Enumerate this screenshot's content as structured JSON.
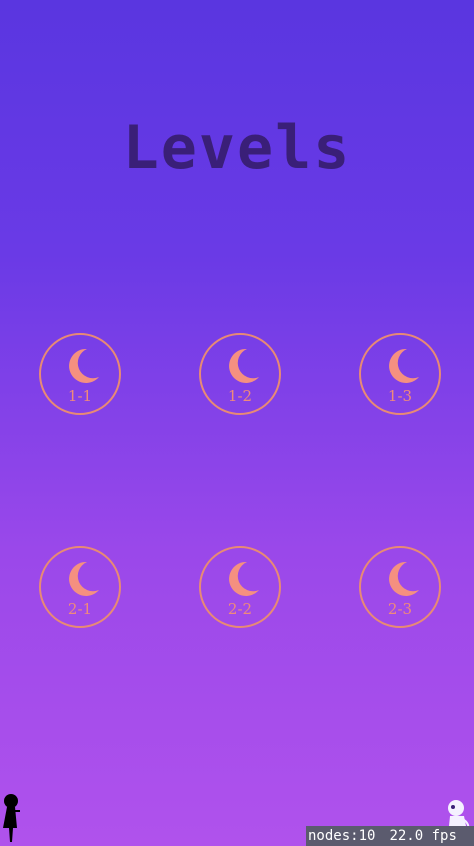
{
  "title": "Levels",
  "levels": [
    {
      "label": "1-1"
    },
    {
      "label": "1-2"
    },
    {
      "label": "1-3"
    },
    {
      "label": "2-1"
    },
    {
      "label": "2-2"
    },
    {
      "label": "2-3"
    }
  ],
  "debug": {
    "nodes": "nodes:10",
    "fps": "22.0 fps"
  },
  "colors": {
    "moon": "#f59080",
    "ring": "#e88a74",
    "title": "#3a1f78"
  }
}
